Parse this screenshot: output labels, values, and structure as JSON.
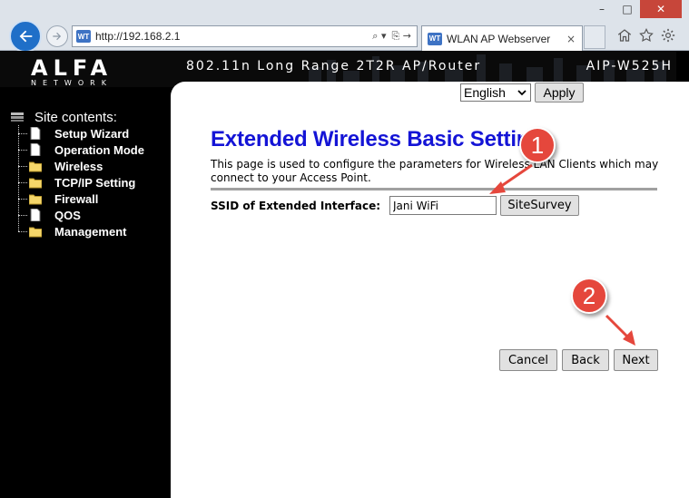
{
  "browser": {
    "window_controls": {
      "minimize": "–",
      "maximize": "□",
      "close": "✕"
    },
    "address_bar": {
      "url": "http://192.168.2.1",
      "search_icon": "⌕ ▾",
      "compat_icon": "⎘ →"
    },
    "tab": {
      "title": "WLAN AP Webserver",
      "close": "×"
    },
    "favicon_text": "WT"
  },
  "router": {
    "logo": "ALFA",
    "logo_sub": "NETWORK",
    "banner_title": "802.11n Long Range 2T2R AP/Router",
    "model": "AIP-W525H",
    "language": {
      "selected": "English",
      "apply_label": "Apply"
    },
    "sidebar": {
      "heading": "Site contents:",
      "items": [
        {
          "label": "Setup Wizard",
          "icon": "page-icon"
        },
        {
          "label": "Operation Mode",
          "icon": "page-icon"
        },
        {
          "label": "Wireless",
          "icon": "folder-icon"
        },
        {
          "label": "TCP/IP Setting",
          "icon": "folder-icon"
        },
        {
          "label": "Firewall",
          "icon": "folder-icon"
        },
        {
          "label": "QOS",
          "icon": "page-icon"
        },
        {
          "label": "Management",
          "icon": "folder-icon"
        }
      ]
    },
    "main": {
      "title": "Extended Wireless Basic Setting",
      "description": "This page is used to configure the parameters for Wireless LAN Clients which may connect to your Access Point.",
      "ssid_label": "SSID of Extended Interface:",
      "ssid_value": "Jani WiFi",
      "sitesurvey_label": "SiteSurvey",
      "cancel_label": "Cancel",
      "back_label": "Back",
      "next_label": "Next"
    }
  },
  "annotations": {
    "step1": "1",
    "step2": "2",
    "color": "#e5473c"
  },
  "colors": {
    "title_blue": "#1414d6",
    "ie_blue": "#1f6fc8",
    "close_red": "#c7463a"
  }
}
